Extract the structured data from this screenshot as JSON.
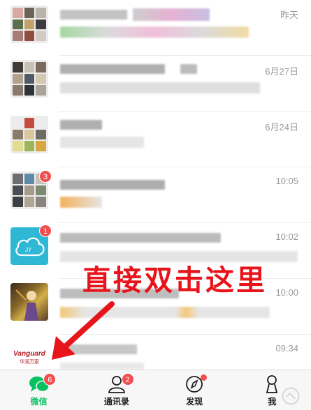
{
  "chats": [
    {
      "time": "昨天"
    },
    {
      "time": "6月27日"
    },
    {
      "time": "6月24日"
    },
    {
      "time": "10:05",
      "badge": "3"
    },
    {
      "time": "10:02",
      "badge": "1",
      "avatar_text": "JY"
    },
    {
      "time": "10:00"
    },
    {
      "time": "09:34",
      "avatar_brand": "Vanguard",
      "avatar_sub": "华润万家"
    }
  ],
  "overlay": {
    "text": "直接双击这里"
  },
  "tabs": [
    {
      "label": "微信",
      "badge": "6",
      "icon": "chat-bubbles-icon"
    },
    {
      "label": "通讯录",
      "badge": "2",
      "icon": "contacts-icon"
    },
    {
      "label": "发现",
      "icon": "compass-icon"
    },
    {
      "label": "我",
      "icon": "person-icon"
    }
  ],
  "colors": {
    "accent": "#07c160",
    "badge": "#f24e4e",
    "overlay": "#e8141b"
  }
}
